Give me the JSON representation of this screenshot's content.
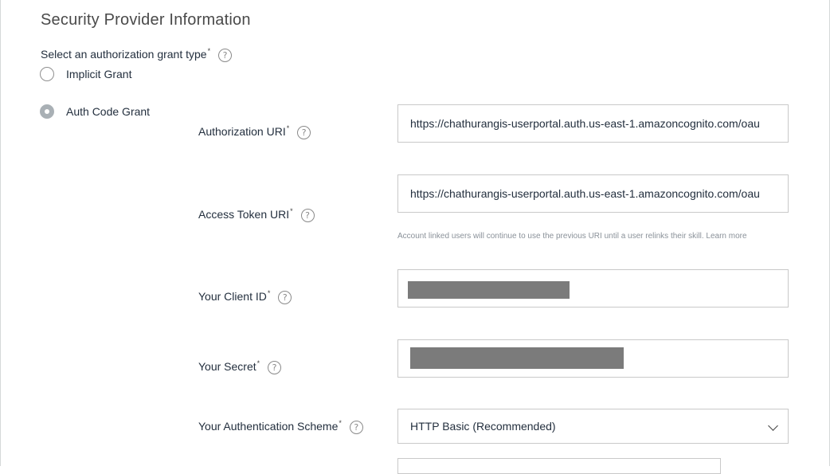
{
  "section": {
    "title": "Security Provider Information"
  },
  "grant_type": {
    "label": "Select an authorization grant type",
    "required_mark": "*",
    "options": [
      {
        "label": "Implicit Grant",
        "selected": false
      },
      {
        "label": "Auth Code Grant",
        "selected": true
      }
    ]
  },
  "fields": {
    "authorization_uri": {
      "label": "Authorization URI",
      "value": "https://chathurangis-userportal.auth.us-east-1.amazoncognito.com/oau"
    },
    "access_token_uri": {
      "label": "Access Token URI",
      "value": "https://chathurangis-userportal.auth.us-east-1.amazoncognito.com/oau"
    },
    "access_token_hint": "Account linked users will continue to use the previous URI until a user relinks their skill. Learn more",
    "client_id": {
      "label": "Your Client ID",
      "value": ""
    },
    "secret": {
      "label": "Your Secret",
      "value": ""
    },
    "auth_scheme": {
      "label": "Your Authentication Scheme",
      "value": "HTTP Basic (Recommended)"
    }
  },
  "help_glyph": "?",
  "icons": {
    "help": "question-circle-icon",
    "dropdown": "chevron-down-icon"
  },
  "colors": {
    "redaction": "#7b7b7b",
    "text": "#232f3e",
    "border": "#c9c9c9"
  }
}
